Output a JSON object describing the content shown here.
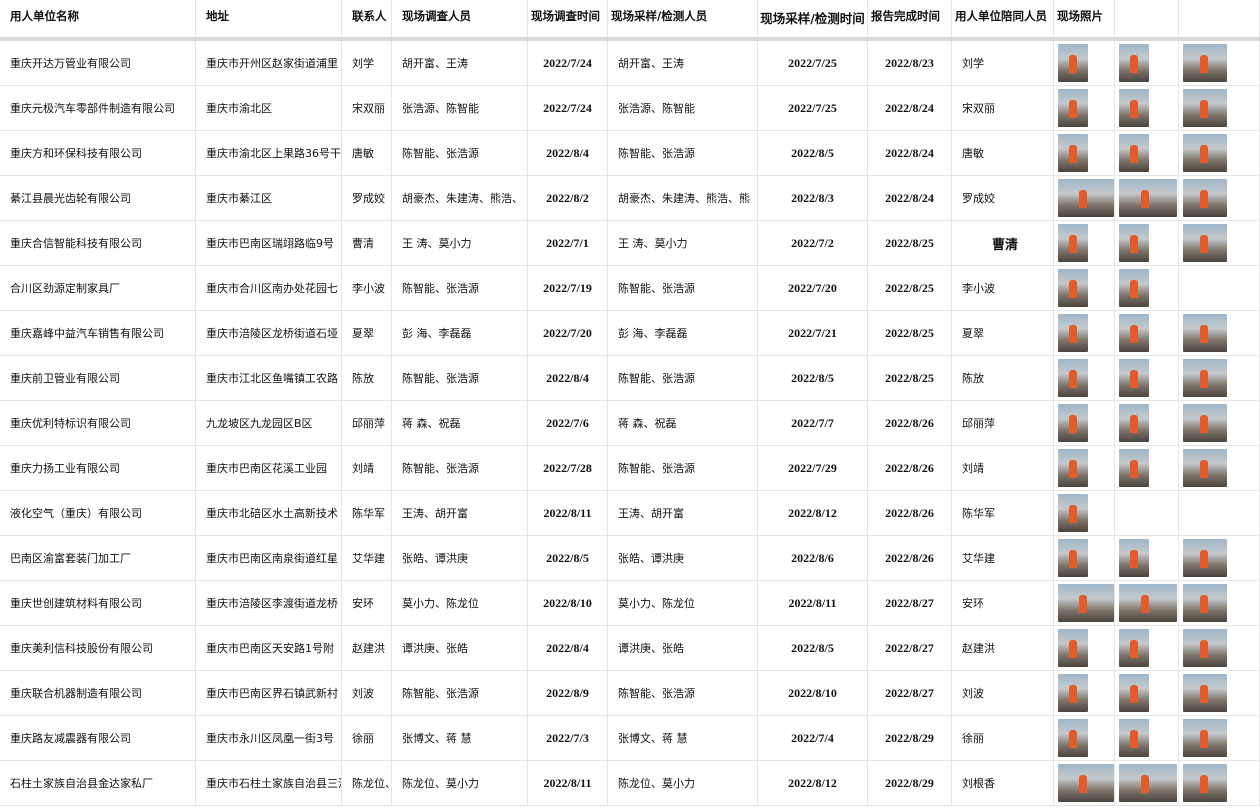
{
  "headers": [
    "用人单位名称",
    "地址",
    "联系人",
    "现场调查人员",
    "现场调查时间",
    "现场采样/检测人员",
    "现场采样/检测时间",
    "报告完成时间",
    "用人单位陪同人员",
    "现场照片"
  ],
  "rows": [
    {
      "company": "重庆开达万管业有限公司",
      "address": "重庆市开州区赵家街道浦里",
      "contact": "刘学",
      "investigators": "胡开富、王涛",
      "survey_date": "2022/7/24",
      "samplers": "胡开富、王涛",
      "sample_date": "2022/7/25",
      "report_date": "2022/8/23",
      "escort": "刘学"
    },
    {
      "company": "重庆元极汽车零部件制造有限公司",
      "address": "重庆市渝北区",
      "contact": "宋双丽",
      "investigators": "张浩源、陈智能",
      "survey_date": "2022/7/24",
      "samplers": "张浩源、陈智能",
      "sample_date": "2022/7/25",
      "report_date": "2022/8/24",
      "escort": "宋双丽"
    },
    {
      "company": "重庆方和环保科技有限公司",
      "address": "重庆市渝北区上果路36号干",
      "contact": "唐敏",
      "investigators": "陈智能、张浩源",
      "survey_date": "2022/8/4",
      "samplers": "陈智能、张浩源",
      "sample_date": "2022/8/5",
      "report_date": "2022/8/24",
      "escort": "唐敏"
    },
    {
      "company": "綦江县晨光齿轮有限公司",
      "address": "重庆市綦江区",
      "contact": "罗成姣",
      "investigators": "胡豪杰、朱建涛、熊浩、",
      "survey_date": "2022/8/2",
      "samplers": "胡豪杰、朱建涛、熊浩、熊",
      "sample_date": "2022/8/3",
      "report_date": "2022/8/24",
      "escort": "罗成姣"
    },
    {
      "company": "重庆合信智能科技有限公司",
      "address": "重庆市巴南区瑞翊路临9号",
      "contact": "曹清",
      "investigators": "王 涛、莫小力",
      "survey_date": "2022/7/1",
      "samplers": "王 涛、莫小力",
      "sample_date": "2022/7/2",
      "report_date": "2022/8/25",
      "escort": "曹清"
    },
    {
      "company": "合川区劲源定制家具厂",
      "address": "重庆市合川区南办处花园七",
      "contact": "李小波",
      "investigators": "陈智能、张浩源",
      "survey_date": "2022/7/19",
      "samplers": "陈智能、张浩源",
      "sample_date": "2022/7/20",
      "report_date": "2022/8/25",
      "escort": "李小波"
    },
    {
      "company": "重庆嘉峰中益汽车销售有限公司",
      "address": "重庆市涪陵区龙桥街道石垭",
      "contact": "夏翠",
      "investigators": "彭 海、李磊磊",
      "survey_date": "2022/7/20",
      "samplers": "彭 海、李磊磊",
      "sample_date": "2022/7/21",
      "report_date": "2022/8/25",
      "escort": "夏翠"
    },
    {
      "company": "重庆前卫管业有限公司",
      "address": "重庆市江北区鱼嘴镇工农路",
      "contact": "陈放",
      "investigators": "陈智能、张浩源",
      "survey_date": "2022/8/4",
      "samplers": "陈智能、张浩源",
      "sample_date": "2022/8/5",
      "report_date": "2022/8/25",
      "escort": "陈放"
    },
    {
      "company": "重庆优利特标识有限公司",
      "address": "九龙坡区九龙园区B区",
      "contact": "邱丽萍",
      "investigators": "蒋 森、祝磊",
      "survey_date": "2022/7/6",
      "samplers": "蒋 森、祝磊",
      "sample_date": "2022/7/7",
      "report_date": "2022/8/26",
      "escort": "邱丽萍"
    },
    {
      "company": "重庆力扬工业有限公司",
      "address": "重庆市巴南区花溪工业园",
      "contact": "刘靖",
      "investigators": "陈智能、张浩源",
      "survey_date": "2022/7/28",
      "samplers": "陈智能、张浩源",
      "sample_date": "2022/7/29",
      "report_date": "2022/8/26",
      "escort": "刘靖"
    },
    {
      "company": "液化空气（重庆）有限公司",
      "address": "重庆市北碚区水土高新技术",
      "contact": "陈华军",
      "investigators": "王涛、胡开富",
      "survey_date": "2022/8/11",
      "samplers": "王涛、胡开富",
      "sample_date": "2022/8/12",
      "report_date": "2022/8/26",
      "escort": "陈华军"
    },
    {
      "company": "巴南区渝富套装门加工厂",
      "address": "重庆市巴南区南泉街道红星",
      "contact": "艾华建",
      "investigators": "张皓、谭洪庚",
      "survey_date": "2022/8/5",
      "samplers": "张皓、谭洪庚",
      "sample_date": "2022/8/6",
      "report_date": "2022/8/26",
      "escort": "艾华建"
    },
    {
      "company": "重庆世创建筑材料有限公司",
      "address": "重庆市涪陵区李渡街道龙桥",
      "contact": "安环",
      "investigators": "莫小力、陈龙位",
      "survey_date": "2022/8/10",
      "samplers": "莫小力、陈龙位",
      "sample_date": "2022/8/11",
      "report_date": "2022/8/27",
      "escort": "安环"
    },
    {
      "company": "重庆美利信科技股份有限公司",
      "address": "重庆市巴南区天安路1号附",
      "contact": "赵建洪",
      "investigators": "谭洪庚、张皓",
      "survey_date": "2022/8/4",
      "samplers": "谭洪庚、张皓",
      "sample_date": "2022/8/5",
      "report_date": "2022/8/27",
      "escort": "赵建洪"
    },
    {
      "company": "重庆联合机器制造有限公司",
      "address": "重庆市巴南区界石镇武新村",
      "contact": "刘波",
      "investigators": "陈智能、张浩源",
      "survey_date": "2022/8/9",
      "samplers": "陈智能、张浩源",
      "sample_date": "2022/8/10",
      "report_date": "2022/8/27",
      "escort": "刘波"
    },
    {
      "company": "重庆路友减震器有限公司",
      "address": "重庆市永川区凤凰一街3号",
      "contact": "徐丽",
      "investigators": "张博文、蒋 慧",
      "survey_date": "2022/7/3",
      "samplers": "张博文、蒋 慧",
      "sample_date": "2022/7/4",
      "report_date": "2022/8/29",
      "escort": "徐丽"
    },
    {
      "company": "石柱土家族自治县金达家私厂",
      "address": "重庆市石柱土家族自治县三河镇川主",
      "contact": "陈龙位、莫小力",
      "investigators": "陈龙位、莫小力",
      "survey_date": "2022/8/11",
      "samplers": "陈龙位、莫小力",
      "sample_date": "2022/8/12",
      "report_date": "2022/8/29",
      "escort": "刘根香"
    }
  ],
  "photo_counts": [
    3,
    3,
    3,
    3,
    3,
    2,
    3,
    3,
    3,
    3,
    1,
    3,
    3,
    3,
    3,
    3,
    3
  ]
}
